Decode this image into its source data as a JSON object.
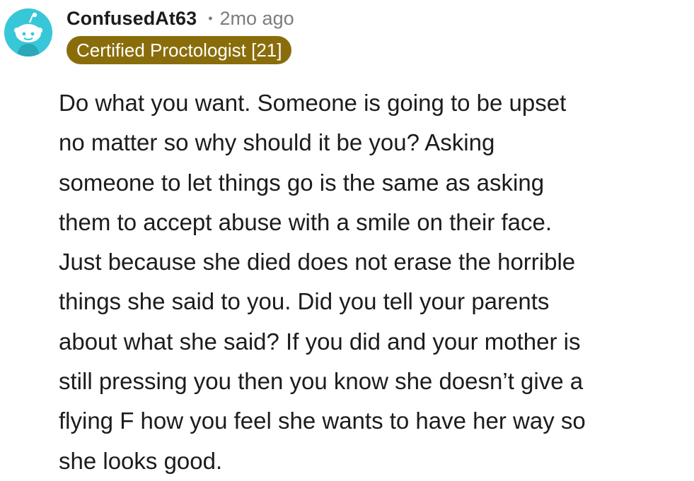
{
  "comment": {
    "username": "ConfusedAt63",
    "separator": "•",
    "age": "2mo ago",
    "flair": "Certified Proctologist [21]",
    "body_lines": [
      "Do what you want. Someone is going to be upset",
      "no matter so why should it be you? Asking",
      "someone to let things go is the same as asking",
      "them to accept abuse with a smile on their face.",
      "Just because she died does not erase the horrible",
      "things she said to you. Did you tell your parents",
      "about what she said? If you did and your mother is",
      "still pressing you then you know she doesn’t give a",
      "flying F how you feel she wants to have her way so",
      "she looks good."
    ]
  },
  "colors": {
    "avatar_background": "#38c7d9",
    "flair_background": "#8a6d0b",
    "username_text": "#1c1c1c",
    "meta_text": "#7c7c7c"
  },
  "icons": {
    "avatar": "reddit-snoo-avatar-icon"
  }
}
